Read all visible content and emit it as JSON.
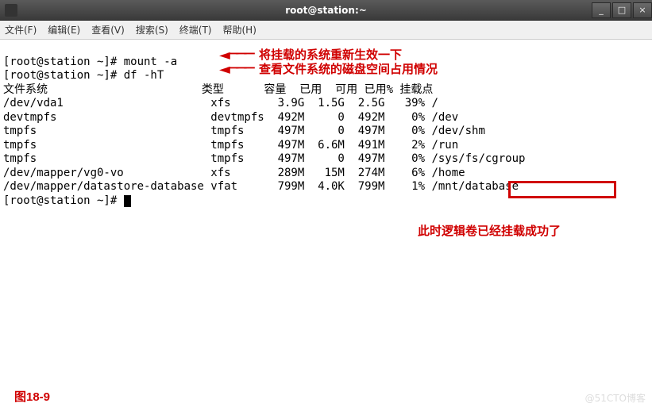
{
  "window": {
    "title": "root@station:~"
  },
  "controls": {
    "min": "_",
    "max": "□",
    "close": "×"
  },
  "menu": [
    "文件(F)",
    "编辑(E)",
    "查看(V)",
    "搜索(S)",
    "终端(T)",
    "帮助(H)"
  ],
  "prompt": "[root@station ~]# ",
  "cmd1": "mount -a",
  "cmd2": "df -hT",
  "header": "文件系统                       类型      容量  已用  可用 已用% 挂载点",
  "rows": [
    "/dev/vda1                      xfs       3.9G  1.5G  2.5G   39% /",
    "devtmpfs                       devtmpfs  492M     0  492M    0% /dev",
    "tmpfs                          tmpfs     497M     0  497M    0% /dev/shm",
    "tmpfs                          tmpfs     497M  6.6M  491M    2% /run",
    "tmpfs                          tmpfs     497M     0  497M    0% /sys/fs/cgroup",
    "/dev/mapper/vg0-vo             xfs       289M   15M  274M    6% /home",
    "/dev/mapper/datastore-database vfat      799M  4.0K  799M    1% /mnt/database"
  ],
  "notes": {
    "n1": "将挂载的系统重新生效一下",
    "n2": "查看文件系统的磁盘空间占用情况",
    "n3": "此时逻辑卷已经挂载成功了"
  },
  "figure": "图18-9",
  "watermark": "@51CTO博客",
  "chart_data": {
    "type": "table",
    "title": "df -hT output",
    "columns": [
      "文件系统",
      "类型",
      "容量",
      "已用",
      "可用",
      "已用%",
      "挂载点"
    ],
    "rows": [
      [
        "/dev/vda1",
        "xfs",
        "3.9G",
        "1.5G",
        "2.5G",
        "39%",
        "/"
      ],
      [
        "devtmpfs",
        "devtmpfs",
        "492M",
        "0",
        "492M",
        "0%",
        "/dev"
      ],
      [
        "tmpfs",
        "tmpfs",
        "497M",
        "0",
        "497M",
        "0%",
        "/dev/shm"
      ],
      [
        "tmpfs",
        "tmpfs",
        "497M",
        "6.6M",
        "491M",
        "2%",
        "/run"
      ],
      [
        "tmpfs",
        "tmpfs",
        "497M",
        "0",
        "497M",
        "0%",
        "/sys/fs/cgroup"
      ],
      [
        "/dev/mapper/vg0-vo",
        "xfs",
        "289M",
        "15M",
        "274M",
        "6%",
        "/home"
      ],
      [
        "/dev/mapper/datastore-database",
        "vfat",
        "799M",
        "4.0K",
        "799M",
        "1%",
        "/mnt/database"
      ]
    ]
  }
}
